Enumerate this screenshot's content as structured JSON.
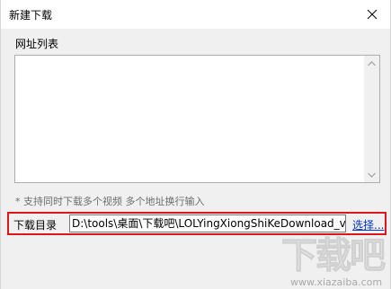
{
  "window": {
    "title": "新建下载"
  },
  "url_list": {
    "label": "网址列表",
    "value": ""
  },
  "hint": "* 支持同时下载多个视频 多个地址换行输入",
  "download_dir": {
    "label": "下载目录",
    "value": "D:\\tools\\桌面\\下载吧\\LOLYingXiongShiKeDownload_v",
    "browse_label": "选择..."
  },
  "watermark": {
    "brand": "下载吧",
    "url": "www.xiazaiba.com"
  },
  "icons": {
    "close": "close-icon",
    "scroll_up": "scroll-up-arrow-icon",
    "scroll_down": "scroll-down-arrow-icon"
  }
}
